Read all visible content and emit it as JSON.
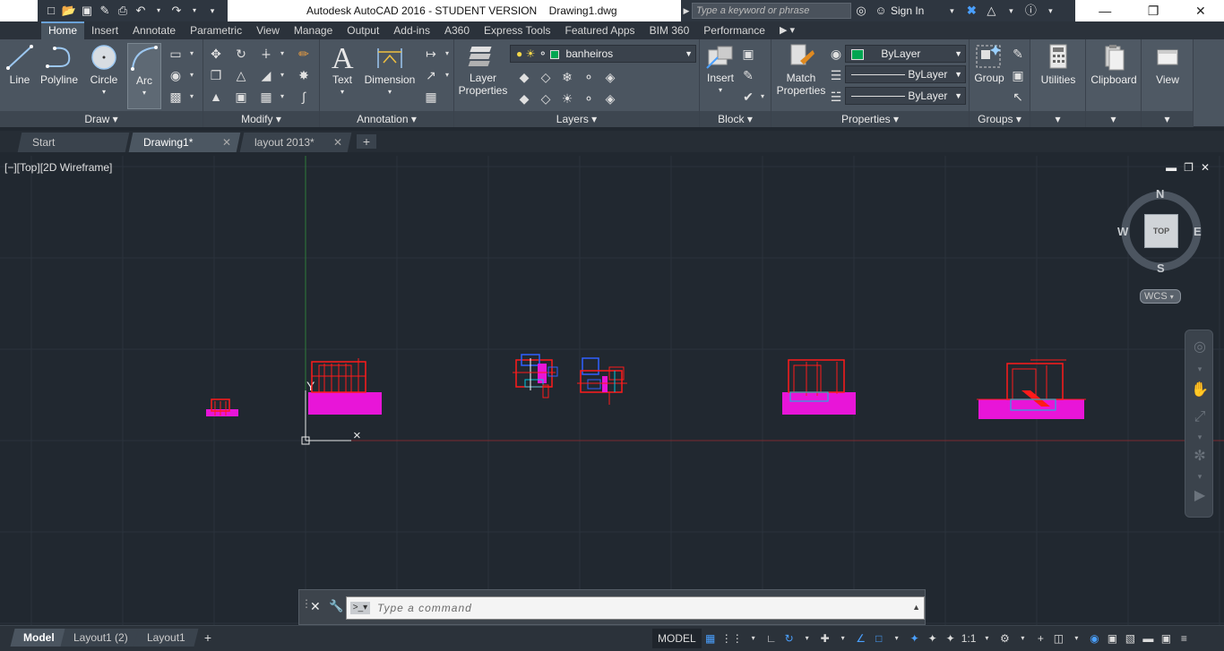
{
  "window": {
    "title": "Autodesk AutoCAD 2016 - STUDENT VERSION",
    "document": "Drawing1.dwg",
    "search_placeholder": "Type a keyword or phrase",
    "sign_in": "Sign In"
  },
  "ribbon_tabs": [
    "Home",
    "Insert",
    "Annotate",
    "Parametric",
    "View",
    "Manage",
    "Output",
    "Add-ins",
    "A360",
    "Express Tools",
    "Featured Apps",
    "BIM 360",
    "Performance"
  ],
  "ribbon": {
    "draw": {
      "footer": "Draw",
      "line": "Line",
      "polyline": "Polyline",
      "circle": "Circle",
      "arc": "Arc"
    },
    "modify": {
      "footer": "Modify"
    },
    "annotation": {
      "footer": "Annotation",
      "text": "Text",
      "dimension": "Dimension"
    },
    "layers": {
      "footer": "Layers",
      "layer_properties_1": "Layer",
      "layer_properties_2": "Properties",
      "current_layer": "banheiros",
      "layer_color": "#00a651"
    },
    "block": {
      "footer": "Block",
      "insert": "Insert"
    },
    "properties": {
      "footer": "Properties",
      "match_1": "Match",
      "match_2": "Properties",
      "color": "ByLayer",
      "linetype": "ByLayer",
      "lineweight": "ByLayer",
      "color_swatch": "#00a651"
    },
    "groups": {
      "footer": "Groups",
      "group": "Group"
    },
    "utilities": {
      "label": "Utilities"
    },
    "clipboard": {
      "label": "Clipboard"
    },
    "view": {
      "label": "View"
    }
  },
  "file_tabs": {
    "start": "Start",
    "drawing1": "Drawing1*",
    "layout2013": "layout 2013*"
  },
  "viewport": {
    "label": "[−][Top][2D Wireframe]",
    "viewcube": {
      "north": "N",
      "south": "S",
      "east": "E",
      "west": "W",
      "top": "TOP",
      "wcs": "WCS"
    }
  },
  "command": {
    "placeholder": "Type a command"
  },
  "layout_tabs": [
    "Model",
    "Layout1 (2)",
    "Layout1"
  ],
  "status": {
    "model": "MODEL",
    "scale": "1:1"
  },
  "colors": {
    "background": "#212830",
    "accent": "#6aa2d8",
    "magenta": "#e815d8",
    "red": "#ff1a1a"
  }
}
